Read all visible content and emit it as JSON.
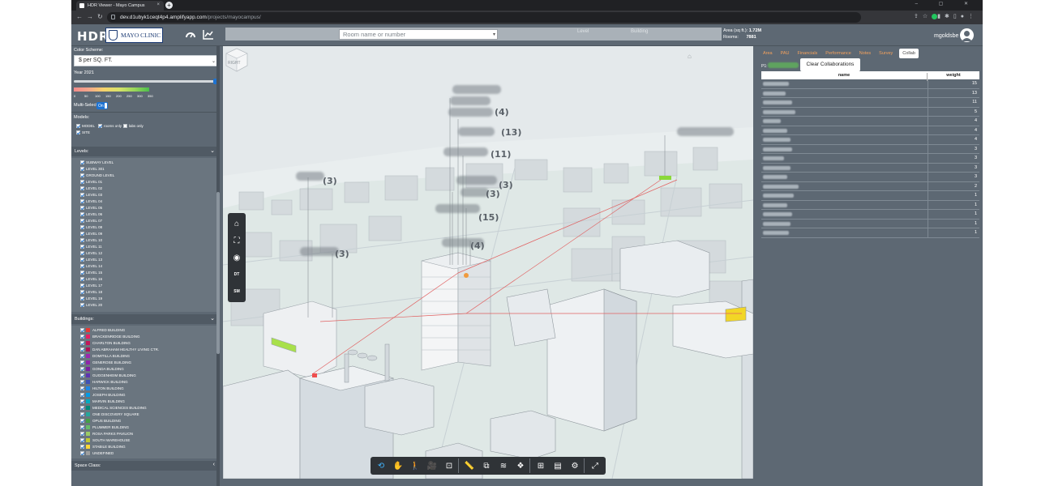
{
  "browser": {
    "tab_title": "HDR Viewer - Mayo Campus",
    "tab_close": "×",
    "new_tab": "+",
    "url_domain": "dev.d1ubyk1ceqt4p4.amplifyapp.com",
    "url_path": "/projects/mayocampus/",
    "window_controls": "–  ▢  ✕"
  },
  "header": {
    "logo": "HDR",
    "client_logo": "MAYO CLINIC",
    "search_placeholder": "Room name or number",
    "level_label": "Level",
    "building_label": "Building",
    "area_label": "Area (sq ft.):",
    "area_value": "1.72M",
    "rooms_label": "Rooms:",
    "rooms_value": "7881",
    "username": "mgoldsbe"
  },
  "left_panel": {
    "color_scheme_label": "Color Scheme:",
    "color_scheme_value": "$ per SQ. FT.",
    "year_label": "Year 2021",
    "year_slider_fraction": 1.0,
    "ramp_ticks": [
      "0",
      "50",
      "100",
      "150",
      "200",
      "250",
      "300",
      "350"
    ],
    "multiselect_label": "Multi-Select:",
    "multiselect_value": "On",
    "models_label": "Models:",
    "models": [
      {
        "label": "MODEL",
        "checked": true
      },
      {
        "label": "rooms only",
        "checked": true
      },
      {
        "label": "labs only",
        "checked": false
      },
      {
        "label": "SITE",
        "checked": true
      }
    ],
    "levels_header": "Levels:",
    "levels": [
      "SUBWAY LEVEL",
      "LEVEL 301",
      "GROUND LEVEL",
      "LEVEL 01",
      "LEVEL 02",
      "LEVEL 03",
      "LEVEL 04",
      "LEVEL 05",
      "LEVEL 06",
      "LEVEL 07",
      "LEVEL 08",
      "LEVEL 09",
      "LEVEL 10",
      "LEVEL 11",
      "LEVEL 12",
      "LEVEL 13",
      "LEVEL 14",
      "LEVEL 15",
      "LEVEL 16",
      "LEVEL 17",
      "LEVEL 18",
      "LEVEL 19",
      "LEVEL 20"
    ],
    "buildings_header": "Buildings:",
    "buildings": [
      {
        "label": "ALFRED BUILDING",
        "color": "#e53935"
      },
      {
        "label": "BRACKENRIDGE BUILDING",
        "color": "#e91e63"
      },
      {
        "label": "CHARLTON BUILDING",
        "color": "#c2185b"
      },
      {
        "label": "DAN ABRAHAM HEALTHY LIVING CTR.",
        "color": "#ad1457"
      },
      {
        "label": "DOMITILLA BUILDING",
        "color": "#9c27b0"
      },
      {
        "label": "GENEROSE BUILDING",
        "color": "#8e24aa"
      },
      {
        "label": "GONDA BUILDING",
        "color": "#7b1fa2"
      },
      {
        "label": "GUGGENHEIM BUILDING",
        "color": "#5e35b1"
      },
      {
        "label": "HARWICK BUILDING",
        "color": "#3f51b5"
      },
      {
        "label": "HILTON BUILDING",
        "color": "#1e88e5"
      },
      {
        "label": "JOSEPH BUILDING",
        "color": "#039be5"
      },
      {
        "label": "MARVIN BUILDING",
        "color": "#00acc1"
      },
      {
        "label": "MEDICAL SCIENCES BUILDING",
        "color": "#00897b"
      },
      {
        "label": "ONE DISCOVERY SQUARE",
        "color": "#26a69a"
      },
      {
        "label": "OPUS BUILDING",
        "color": "#43a047"
      },
      {
        "label": "PLUMMER BUILDING",
        "color": "#66bb6a"
      },
      {
        "label": "ROSA PARKS PAVILION",
        "color": "#9ccc65"
      },
      {
        "label": "SOUTH WAREHOUSE",
        "color": "#c0ca33"
      },
      {
        "label": "STABILE BUILDING",
        "color": "#fdd835"
      },
      {
        "label": "UNDEFINED",
        "color": "#9e9e9e"
      }
    ],
    "space_class_header": "Space Class:"
  },
  "viewport": {
    "counts": [
      "(4)",
      "(13)",
      "(11)",
      "(3)",
      "(3)",
      "(3)",
      "(15)",
      "(4)",
      "(3)"
    ],
    "view_cube_label": "RIGHT",
    "side_tools": [
      {
        "icon": "home-icon",
        "glyph": "⌂"
      },
      {
        "icon": "fit-view-icon",
        "glyph": "⛶"
      },
      {
        "icon": "eye-icon",
        "glyph": "◉"
      },
      {
        "icon": "dt-button",
        "glyph": "DT"
      },
      {
        "icon": "sm-button",
        "glyph": "SM"
      }
    ],
    "bottom_tools": [
      {
        "icon": "orbit-icon",
        "glyph": "⟲"
      },
      {
        "icon": "pan-icon",
        "glyph": "✋"
      },
      {
        "icon": "walk-icon",
        "glyph": "🚶"
      },
      {
        "icon": "camera-icon",
        "glyph": "🎥"
      },
      {
        "icon": "fit-icon",
        "glyph": "⊡"
      },
      {
        "icon": "measure-icon",
        "glyph": "📏"
      },
      {
        "icon": "section-icon",
        "glyph": "⧉"
      },
      {
        "icon": "layers-icon",
        "glyph": "≋"
      },
      {
        "icon": "explode-icon",
        "glyph": "❖"
      },
      {
        "icon": "model-browser-icon",
        "glyph": "⊞"
      },
      {
        "icon": "properties-icon",
        "glyph": "▤"
      },
      {
        "icon": "settings-icon",
        "glyph": "⚙"
      },
      {
        "icon": "fullscreen-icon",
        "glyph": "⤢"
      }
    ]
  },
  "right_panel": {
    "tabs": [
      "Area",
      "PAU",
      "Financials",
      "Performance",
      "Notes",
      "Survey",
      "Collab"
    ],
    "active_tab": "Collab",
    "p1_label": "P1:",
    "clear_button": "Clear Collaborations",
    "table_headers": [
      "name",
      "weight"
    ],
    "weights": [
      "15",
      "13",
      "11",
      "5",
      "4",
      "4",
      "4",
      "3",
      "3",
      "3",
      "3",
      "2",
      "1",
      "1",
      "1",
      "1",
      "1"
    ]
  }
}
